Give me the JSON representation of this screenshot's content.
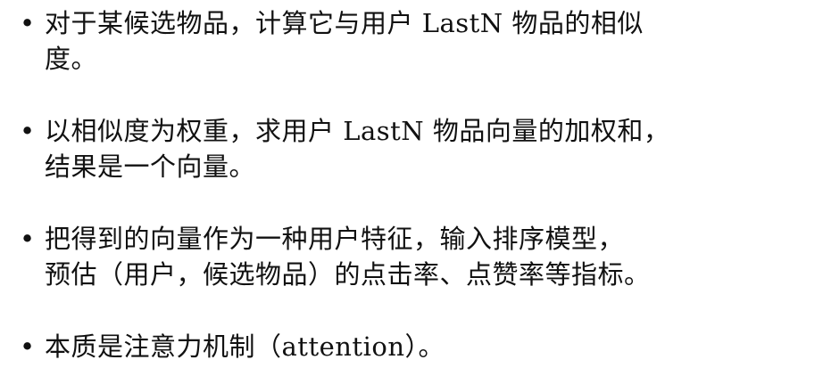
{
  "bullet_symbol": "•",
  "bullets": [
    {
      "lines": [
        "对于某候选物品，计算它与用户 LastN 物品的相似",
        "度。"
      ]
    },
    {
      "lines": [
        "以相似度为权重，求用户 LastN 物品向量的加权和，",
        "结果是一个向量。"
      ]
    },
    {
      "lines": [
        "把得到的向量作为一种用户特征，输入排序模型，",
        "预估（用户，候选物品）的点击率、点赞率等指标。"
      ]
    },
    {
      "lines": [
        "本质是注意力机制（attention）。"
      ]
    }
  ]
}
